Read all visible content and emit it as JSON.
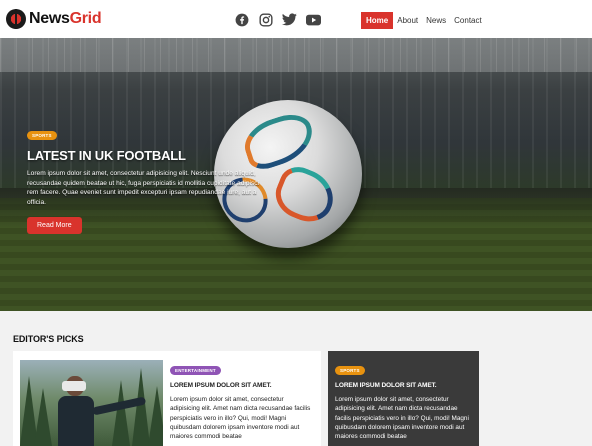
{
  "brand": {
    "name_part1": "News",
    "name_part2": "Grid"
  },
  "social": {
    "icons": [
      "facebook-icon",
      "instagram-icon",
      "twitter-icon",
      "youtube-icon"
    ]
  },
  "nav": {
    "items": [
      {
        "label": "Home",
        "active": true
      },
      {
        "label": "About",
        "active": false
      },
      {
        "label": "News",
        "active": false
      },
      {
        "label": "Contact",
        "active": false
      }
    ]
  },
  "hero": {
    "badge": "SPORTS",
    "title": "LATEST IN UK FOOTBALL",
    "text": "Lorem ipsum dolor sit amet, consectetur adipisicing elit. Nesciunt unde aliquid, recusandae quidem beatae ut hic, fuga perspiciatis id mollitia cupiditate adipisci rem facere. Quae eveniet sunt impedit excepturi ipsam repudiandae iure, aut a officia.",
    "button": "Read More"
  },
  "editors_picks": {
    "title": "EDITOR'S PICKS",
    "cards": [
      {
        "badge": "ENTERTAINMENT",
        "title": "LOREM IPSUM DOLOR SIT AMET.",
        "text": "Lorem ipsum dolor sit amet, consectetur adipisicing elit. Amet nam dicta recusandae facilis perspiciatis vero in illo? Qui, modi! Magni quibusdam dolorem ipsam inventore modi aut maiores commodi beatae"
      },
      {
        "badge": "SPORTS",
        "title": "LOREM IPSUM DOLOR SIT AMET.",
        "text": "Lorem ipsum dolor sit amet, consectetur adipisicing elit. Amet nam dicta recusandae facilis perspiciatis vero in illo? Qui, modi! Magni quibusdam dolorem ipsam inventore modi aut maiores commodi beatae"
      }
    ]
  },
  "colors": {
    "accent": "#d9332c",
    "sports_badge": "#e8920f",
    "entertainment_badge": "#8f54b5",
    "dark_card": "#3a3a3a"
  }
}
